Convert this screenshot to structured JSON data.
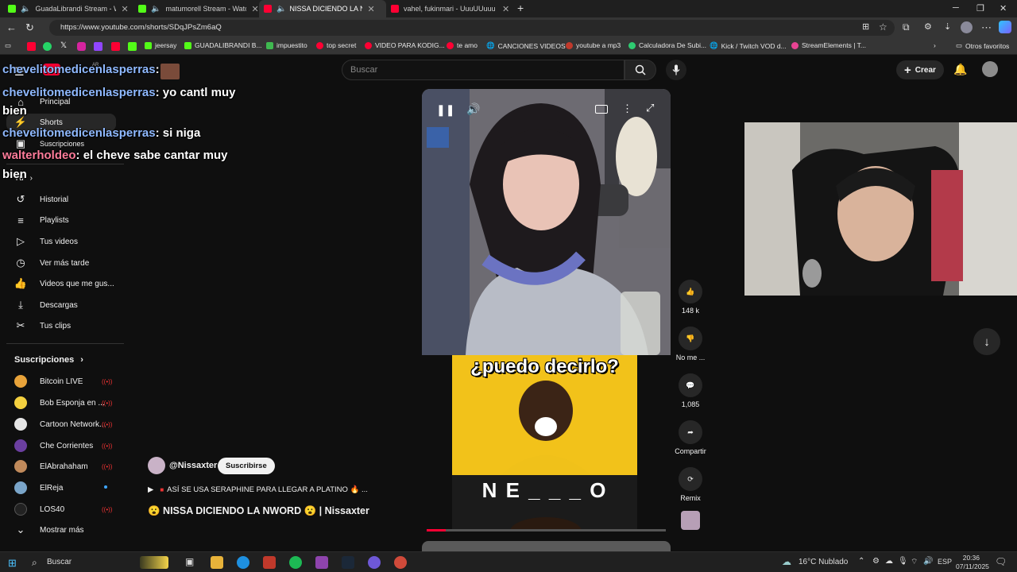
{
  "browser": {
    "tabs": [
      {
        "title": "GuadaLibrandi Stream - Wat",
        "active": false
      },
      {
        "title": "matumorell Stream - Watch",
        "active": false
      },
      {
        "title": "NISSA DICIENDO LA NWO",
        "active": true
      },
      {
        "title": "vahel, fukinmari - UuuUUuuu - Yo",
        "active": false
      }
    ],
    "url": "https://www.youtube.com/shorts/SDqJPsZm6aQ",
    "bookmarks": [
      "jeersay",
      "GUADALIBRANDI B...",
      "impuestito",
      "top secret",
      "VIDEO PARA KODIG...",
      "te amo",
      "CANCIONES VIDEOS",
      "youtube a mp3",
      "Calculadora De Subi...",
      "Kick / Twitch VOD d...",
      "StreamElements | T...",
      "Otros favoritos"
    ]
  },
  "chat": [
    {
      "user": "chevelitomedicenlasperras",
      "msg": ""
    },
    {
      "user": "chevelitomedicenlasperras",
      "msg": "yo cantl muy"
    },
    {
      "user": "",
      "msg": "bien"
    },
    {
      "user": "chevelitomedicenlasperras",
      "msg": "si niga"
    },
    {
      "user": "walterholdeo",
      "msg": "el cheve sabe cantar muy"
    },
    {
      "user": "",
      "msg": "bien"
    }
  ],
  "youtube": {
    "logo_country": "AR",
    "search_placeholder": "Buscar",
    "create_label": "Crear",
    "nav": [
      {
        "label": "Principal"
      },
      {
        "label": "Shorts"
      },
      {
        "label": "Suscripciones"
      },
      {
        "label": "Tú"
      }
    ],
    "you_items": [
      {
        "label": "Historial",
        "icon": "history-icon"
      },
      {
        "label": "Playlists",
        "icon": "playlist-icon"
      },
      {
        "label": "Tus videos",
        "icon": "your-videos-icon"
      },
      {
        "label": "Ver más tarde",
        "icon": "clock-icon"
      },
      {
        "label": "Videos que me gus...",
        "icon": "thumbs-up-icon"
      },
      {
        "label": "Descargas",
        "icon": "download-icon"
      },
      {
        "label": "Tus clips",
        "icon": "scissors-icon"
      }
    ],
    "subscriptions_header": "Suscripciones",
    "subscriptions": [
      {
        "name": "Bitcoin LIVE",
        "color": "#e8a33a",
        "status": "live"
      },
      {
        "name": "Bob Esponja en ...",
        "color": "#f4d03f",
        "status": "live"
      },
      {
        "name": "Cartoon Network...",
        "color": "#e5e5e5",
        "status": "live"
      },
      {
        "name": "Che Corrientes",
        "color": "#6b3fa0",
        "status": "live"
      },
      {
        "name": "ElAbrahaham",
        "color": "#c08a5b",
        "status": "live"
      },
      {
        "name": "ElReja",
        "color": "#7aa5c9",
        "status": "new"
      },
      {
        "name": "LOS40",
        "color": "#222222",
        "status": "live"
      }
    ],
    "show_more": "Mostrar más",
    "short": {
      "channel": "@Nissaxter",
      "subscribe": "Suscribirse",
      "music_line": "ASÍ SE USA SERAPHINE PARA LLEGAR A PLATINO 🔥 ...",
      "title": "😮 NISSA DICIENDO LA NWORD 😮 | Nissaxter",
      "caption_big": "¿puedo decirlo?",
      "caption_word": "N E _ _ _ O",
      "likes": "148 k",
      "dislike_label": "No me ...",
      "comments": "1,085",
      "share_label": "Compartir",
      "remix_label": "Remix",
      "progress_fraction": 0.08
    }
  },
  "taskbar": {
    "search_label": "Buscar",
    "weather": "16°C Nublado",
    "lang": "ESP",
    "time": "20:36",
    "date": "07/11/2025"
  }
}
